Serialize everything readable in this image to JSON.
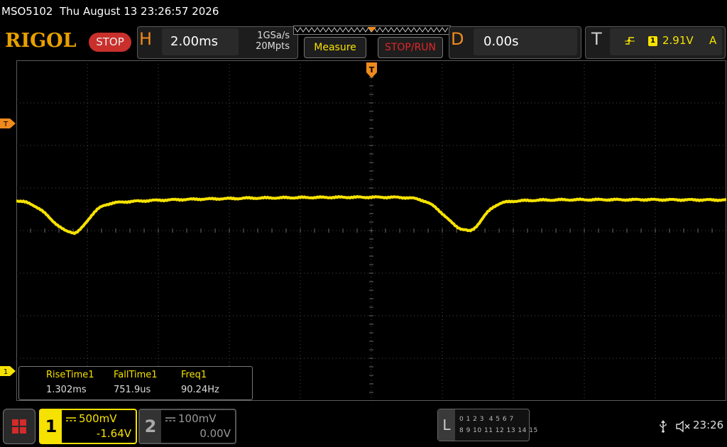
{
  "titlebar": {
    "model": "MSO5102",
    "datetime": "Thu August 13 23:26:57 2026"
  },
  "brand": {
    "logo": "RIGOL",
    "run_state": "STOP"
  },
  "horizontal": {
    "letter": "H",
    "timebase": "2.00ms",
    "sample_rate": "1GSa/s",
    "memory_depth": "20Mpts"
  },
  "buttons": {
    "measure": "Measure",
    "stop_run": "STOP/RUN"
  },
  "delay": {
    "letter": "D",
    "value": "0.00s"
  },
  "trigger": {
    "letter": "T",
    "edge_icon": "rising-edge-icon",
    "source": "1",
    "level": "2.91V",
    "mode": "A"
  },
  "markers": {
    "trigger_position": "T",
    "trigger_level": "T",
    "ch1_offset": "1"
  },
  "measurements": [
    {
      "label": "RiseTime1",
      "value": "1.302ms"
    },
    {
      "label": "FallTime1",
      "value": "751.9us"
    },
    {
      "label": "Freq1",
      "value": "90.24Hz"
    }
  ],
  "channels": [
    {
      "num": "1",
      "scale": "500mV",
      "offset": "-1.64V",
      "color": "#f6e200",
      "active": true
    },
    {
      "num": "2",
      "scale": "100mV",
      "offset": "0.00V",
      "color": "#999999",
      "active": false
    }
  ],
  "logic_analyzer": {
    "letter": "L",
    "row1": "0 1 2 3  4 5 6 7",
    "row2": "8 9 10 11 12 13 14 15"
  },
  "status": {
    "usb_icon": "usb-icon",
    "speaker_icon": "mute-speaker-icon",
    "clock": "23:26"
  },
  "colors": {
    "ch1": "#f6e200",
    "accent": "#f08a1c",
    "stop": "#c9302c",
    "grid": "#4a4a4a"
  }
}
